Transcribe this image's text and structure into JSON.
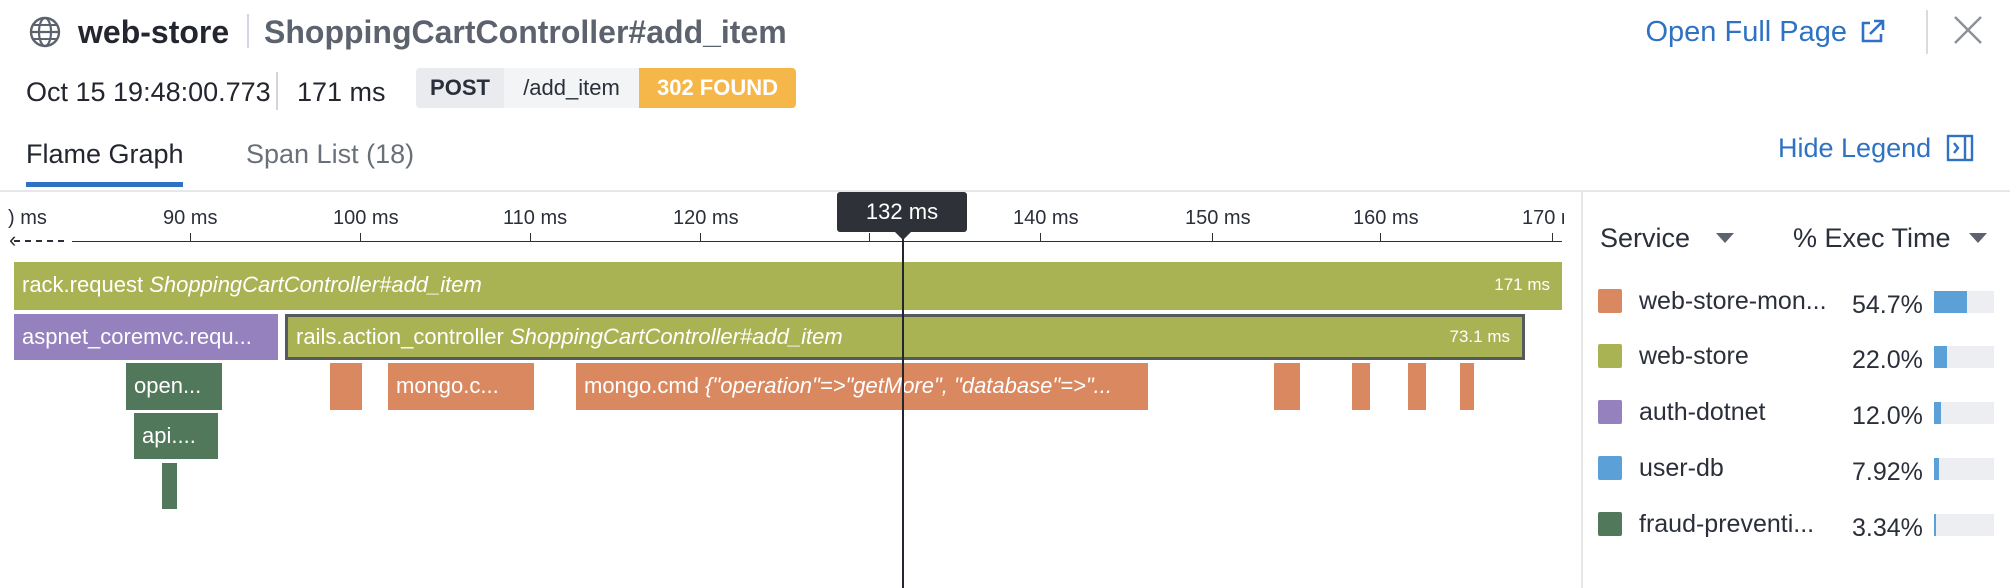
{
  "header": {
    "service": "web-store",
    "resource": "ShoppingCartController#add_item",
    "open_full_page": "Open Full Page",
    "globe_icon": "globe-icon",
    "external_icon": "external-link-icon",
    "close_icon": "close-icon"
  },
  "meta": {
    "timestamp": "Oct 15 19:48:00.773",
    "duration": "171 ms",
    "method": "POST",
    "path": "/add_item",
    "status": "302 FOUND"
  },
  "tabs": {
    "flame": "Flame Graph",
    "span_list": "Span List (18)",
    "hide_legend": "Hide Legend"
  },
  "timeline": {
    "ticks": [
      ") ms",
      "90 ms",
      "100 ms",
      "110 ms",
      "120 ms",
      "130 ms",
      "140 ms",
      "150 ms",
      "160 ms",
      "170 r"
    ],
    "cursor": "132 ms"
  },
  "spans": {
    "rack": {
      "name": "rack.request",
      "resource": "ShoppingCartController#add_item",
      "duration": "171 ms"
    },
    "aspnet": {
      "name": "aspnet_coremvc.requ..."
    },
    "rails": {
      "name": "rails.action_controller",
      "resource": "ShoppingCartController#add_item",
      "duration": "73.1 ms"
    },
    "open": {
      "name": "open..."
    },
    "mongo_c": {
      "name": "mongo.c..."
    },
    "mongo_cmd": {
      "name": "mongo.cmd",
      "resource": "{\"operation\"=>\"getMore\", \"database\"=>\"..."
    },
    "api": {
      "name": "api...."
    }
  },
  "legend": {
    "service_header": "Service",
    "exec_header": "% Exec Time",
    "items": [
      {
        "name": "web-store-mon...",
        "pct": "54.7%",
        "value": 0.547,
        "color": "#da8860"
      },
      {
        "name": "web-store",
        "pct": "22.0%",
        "value": 0.22,
        "color": "#aab354"
      },
      {
        "name": "auth-dotnet",
        "pct": "12.0%",
        "value": 0.12,
        "color": "#9481be"
      },
      {
        "name": "user-db",
        "pct": "7.92%",
        "value": 0.0792,
        "color": "#5ba0d6"
      },
      {
        "name": "fraud-preventi...",
        "pct": "3.34%",
        "value": 0.0334,
        "color": "#52785c"
      }
    ]
  }
}
